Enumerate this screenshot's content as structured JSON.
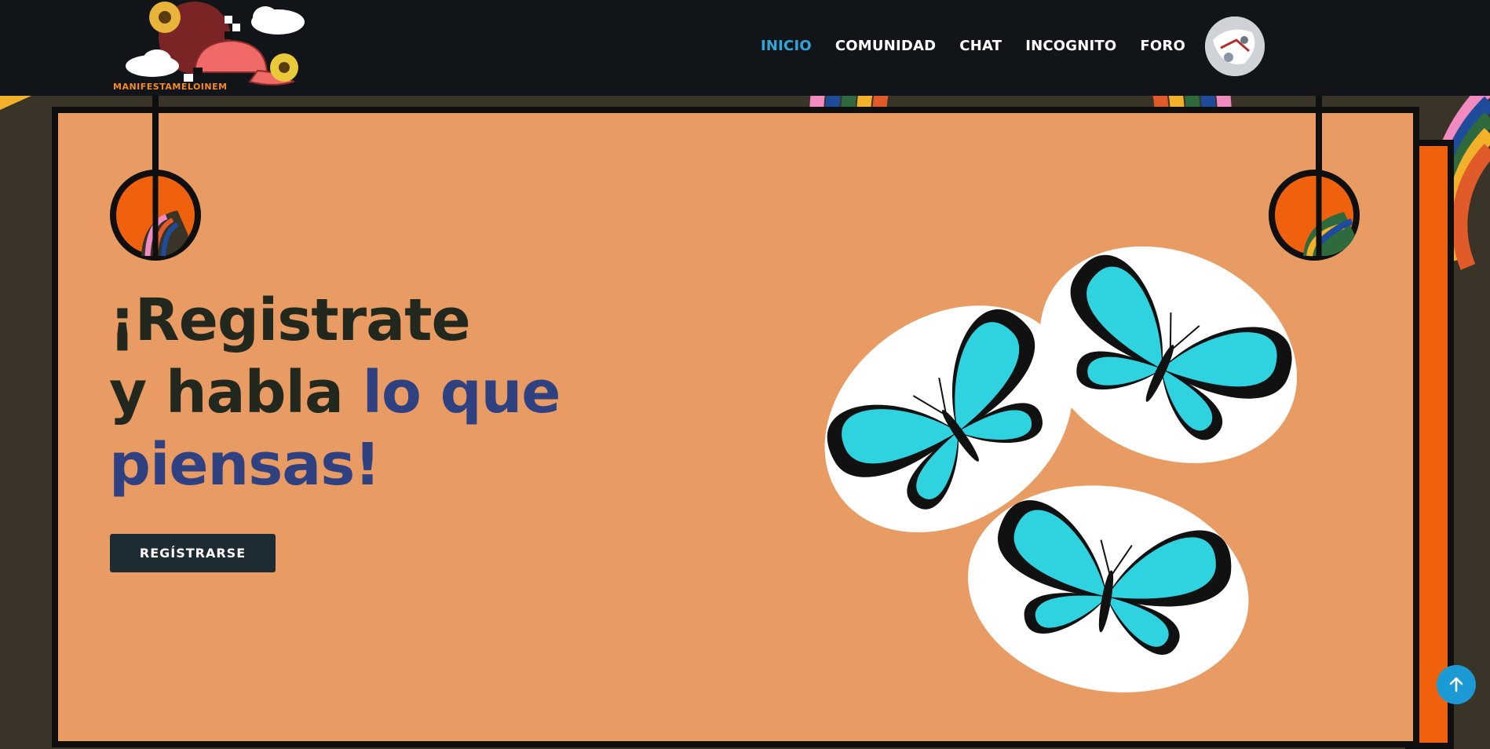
{
  "brand": {
    "logo_text": "MANIFESTAMELOINEM",
    "accent": "#2fa6d8",
    "nav_bg": "#11151a",
    "card_color": "#e89c63",
    "headline_dark": "#23281f",
    "headline_blue": "#2f4181"
  },
  "nav": {
    "items": [
      {
        "label": "INICIO",
        "active": true
      },
      {
        "label": "COMUNIDAD",
        "active": false
      },
      {
        "label": "CHAT",
        "active": false
      },
      {
        "label": "INCOGNITO",
        "active": false
      },
      {
        "label": "FORO",
        "active": false
      }
    ]
  },
  "hero": {
    "line1": "¡Registrate",
    "line2_dark": "y habla ",
    "line2_blue": "lo que",
    "line3_blue": "piensas!",
    "cta_label": "REGÍSTRARSE"
  },
  "icons": {
    "logo": "cap-sunflower-logo-icon",
    "avatar": "user-avatar",
    "butterflies": "butterfly-stickers-icon",
    "scroll_top": "arrow-up-icon"
  }
}
